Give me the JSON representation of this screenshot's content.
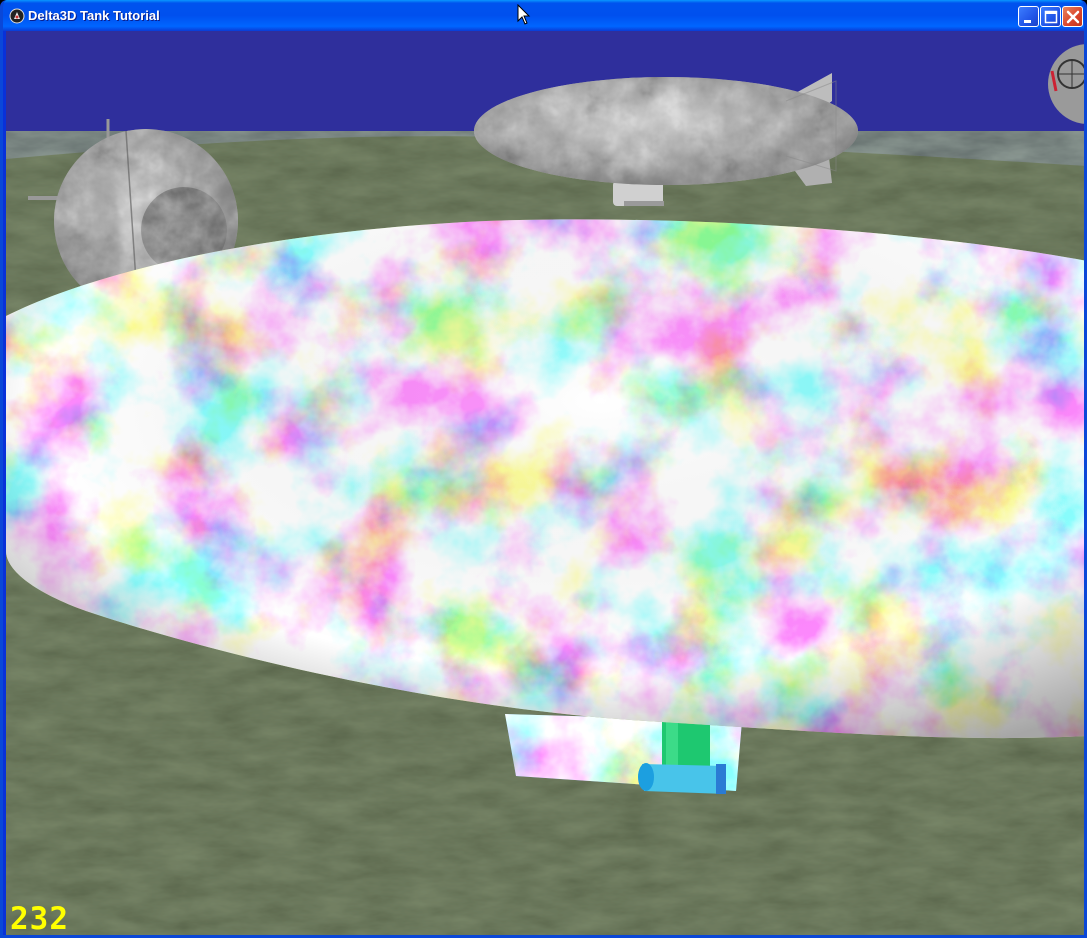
{
  "window": {
    "title": "Delta3D Tank Tutorial",
    "app_icon": "delta3d-icon",
    "controls": [
      "minimize-icon",
      "maximize-icon",
      "close-icon"
    ]
  },
  "overlay": {
    "fps_counter": "232"
  },
  "colors": {
    "sky": "#2f2f9c",
    "ground": "#3e4a34",
    "titlebar": "#0054e3",
    "fps_text": "#ffff00",
    "close_button": "#d9432b"
  }
}
